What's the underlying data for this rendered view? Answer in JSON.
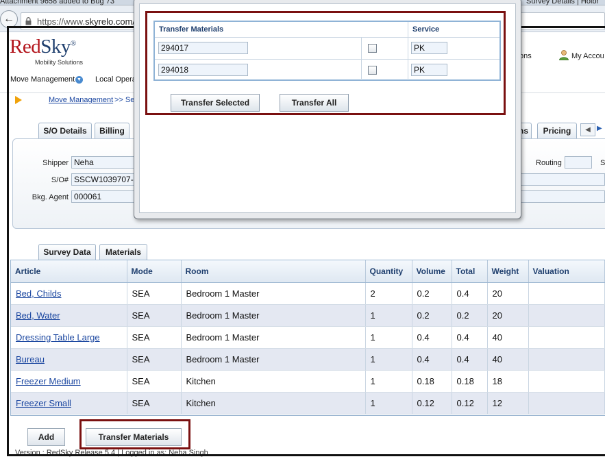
{
  "browser": {
    "tab_left": "Attachment 9658 added to Bug 73",
    "tab_right": "Survey Details | Holbr",
    "url_prefix": "https://www.",
    "url_domain": "skyrelo.com/"
  },
  "header": {
    "logo_red": "Red",
    "logo_sky": "Sky",
    "logo_reg": "®",
    "logo_sub": "Mobility Solutions",
    "nav_right": "ons",
    "my_account": "My Accou"
  },
  "nav": {
    "move_management": "Move Management",
    "local_ops": "Local Opera"
  },
  "breadcrumb": {
    "link": "Move Management",
    "sep": ">> Se"
  },
  "top_tabs": {
    "so_details": "S/O Details",
    "billing": "Billing",
    "partial": "ns",
    "pricing": "Pricing"
  },
  "form": {
    "shipper_label": "Shipper",
    "shipper_value": "Neha",
    "so_label": "S/O#",
    "so_value": "SSCW1039707-",
    "agent_label": "Bkg. Agent",
    "agent_value": "000061",
    "routing_label": "Routing",
    "routing_value": "",
    "s_label": "S"
  },
  "sub_tabs": {
    "survey_data": "Survey Data",
    "materials": "Materials"
  },
  "grid": {
    "columns": [
      "Article",
      "Mode",
      "Room",
      "Quantity",
      "Volume",
      "Total",
      "Weight",
      "Valuation"
    ],
    "rows": [
      {
        "article": "Bed, Childs",
        "mode": "SEA",
        "room": "Bedroom 1 Master",
        "quantity": "2",
        "volume": "0.2",
        "total": "0.4",
        "weight": "20",
        "valuation": ""
      },
      {
        "article": "Bed, Water",
        "mode": "SEA",
        "room": "Bedroom 1 Master",
        "quantity": "1",
        "volume": "0.2",
        "total": "0.2",
        "weight": "20",
        "valuation": ""
      },
      {
        "article": "Dressing Table Large",
        "mode": "SEA",
        "room": "Bedroom 1 Master",
        "quantity": "1",
        "volume": "0.4",
        "total": "0.4",
        "weight": "40",
        "valuation": ""
      },
      {
        "article": "Bureau",
        "mode": "SEA",
        "room": "Bedroom 1 Master",
        "quantity": "1",
        "volume": "0.4",
        "total": "0.4",
        "weight": "40",
        "valuation": ""
      },
      {
        "article": "Freezer Medium",
        "mode": "SEA",
        "room": "Kitchen",
        "quantity": "1",
        "volume": "0.18",
        "total": "0.18",
        "weight": "18",
        "valuation": ""
      },
      {
        "article": "Freezer Small",
        "mode": "SEA",
        "room": "Kitchen",
        "quantity": "1",
        "volume": "0.12",
        "total": "0.12",
        "weight": "12",
        "valuation": ""
      }
    ]
  },
  "actions": {
    "add": "Add",
    "transfer_materials": "Transfer Materials"
  },
  "footer": {
    "text": "Version : RedSky Release 5.4 | Logged in as: Neha Singh"
  },
  "modal": {
    "col_transfer": "Transfer Materials",
    "col_service": "Service",
    "rows": [
      {
        "material": "294017",
        "checked": false,
        "service": "PK"
      },
      {
        "material": "294018",
        "checked": false,
        "service": "PK"
      }
    ],
    "btn_transfer_selected": "Transfer Selected",
    "btn_transfer_all": "Transfer All"
  },
  "colors": {
    "highlight": "#7a1010",
    "link": "#1a46a0",
    "header_text": "#1f3f6e",
    "logo_red": "#b3151c"
  }
}
